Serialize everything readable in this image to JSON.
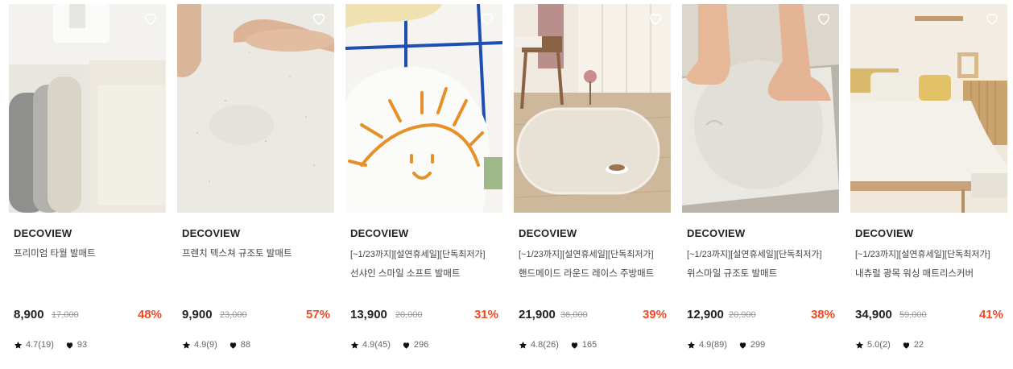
{
  "colors": {
    "discount": "#f04a23",
    "brand_text": "#222222",
    "muted": "#999999"
  },
  "products": [
    {
      "brand": "DECOVIEW",
      "promo": "",
      "name": "프리미엄 타월 발매트",
      "price": "8,900",
      "original_price": "17,000",
      "discount": "48%",
      "rating": "4.7(19)",
      "likes": "93"
    },
    {
      "brand": "DECOVIEW",
      "promo": "",
      "name": "프렌치 텍스쳐 규조토 발매트",
      "price": "9,900",
      "original_price": "23,000",
      "discount": "57%",
      "rating": "4.9(9)",
      "likes": "88"
    },
    {
      "brand": "DECOVIEW",
      "promo": "[~1/23까지][설연휴세일][단독최저가]",
      "name": "선샤인 스마일 소프트 발매트",
      "price": "13,900",
      "original_price": "20,000",
      "discount": "31%",
      "rating": "4.9(45)",
      "likes": "296"
    },
    {
      "brand": "DECOVIEW",
      "promo": "[~1/23까지][설연휴세일][단독최저가]",
      "name": "핸드메이드 라운드 레이스 주방매트",
      "price": "21,900",
      "original_price": "36,000",
      "discount": "39%",
      "rating": "4.8(26)",
      "likes": "165"
    },
    {
      "brand": "DECOVIEW",
      "promo": "[~1/23까지][설연휴세일][단독최저가]",
      "name": "위스마일 규조토 발매트",
      "price": "12,900",
      "original_price": "20,900",
      "discount": "38%",
      "rating": "4.9(89)",
      "likes": "299"
    },
    {
      "brand": "DECOVIEW",
      "promo": "[~1/23까지][설연휴세일][단독최저가]",
      "name": "내츄럴 광목 워싱 매트리스커버",
      "price": "34,900",
      "original_price": "59,000",
      "discount": "41%",
      "rating": "5.0(2)",
      "likes": "22"
    }
  ]
}
